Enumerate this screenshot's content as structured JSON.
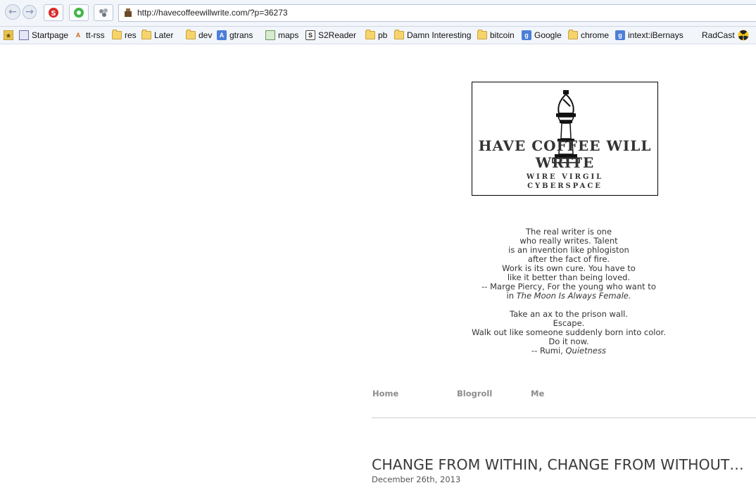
{
  "browser": {
    "url": "http://havecoffeewillwrite.com/?p=36273",
    "bookmarks": [
      "Startpage",
      "tt-rss",
      "res",
      "Later",
      "dev",
      "gtrans",
      "maps",
      "S2Reader",
      "pb",
      "Damn Interesting",
      "bitcoin",
      "Google",
      "chrome",
      "intext:iBernays",
      "RadCast"
    ]
  },
  "logo": {
    "title": "HAVE COFFEE WILL WRITE",
    "sub1": "WIRE VIRGIL",
    "sub2": "CYBERSPACE"
  },
  "quote1": {
    "l1": "The real writer is one",
    "l2": "who really writes. Talent",
    "l3": "is an invention like phlogiston",
    "l4": "after the fact of fire.",
    "l5": "Work is its own cure. You have to",
    "l6": "like it better than being loved.",
    "l7": "-- Marge Piercy, For the young who want to",
    "l8a": "in ",
    "l8b": "The Moon Is Always Female."
  },
  "quote2": {
    "l1": "Take an ax to the prison wall.",
    "l2": "Escape.",
    "l3": "Walk out like someone suddenly born into color.",
    "l4": "Do it now.",
    "l5a": "-- Rumi, ",
    "l5b": "Quietness"
  },
  "menu": {
    "home": "Home",
    "blogroll": "Blogroll",
    "me": "Me"
  },
  "post": {
    "title": "CHANGE FROM WITHIN, CHANGE FROM WITHOUT…",
    "date": "December 26th, 2013"
  }
}
